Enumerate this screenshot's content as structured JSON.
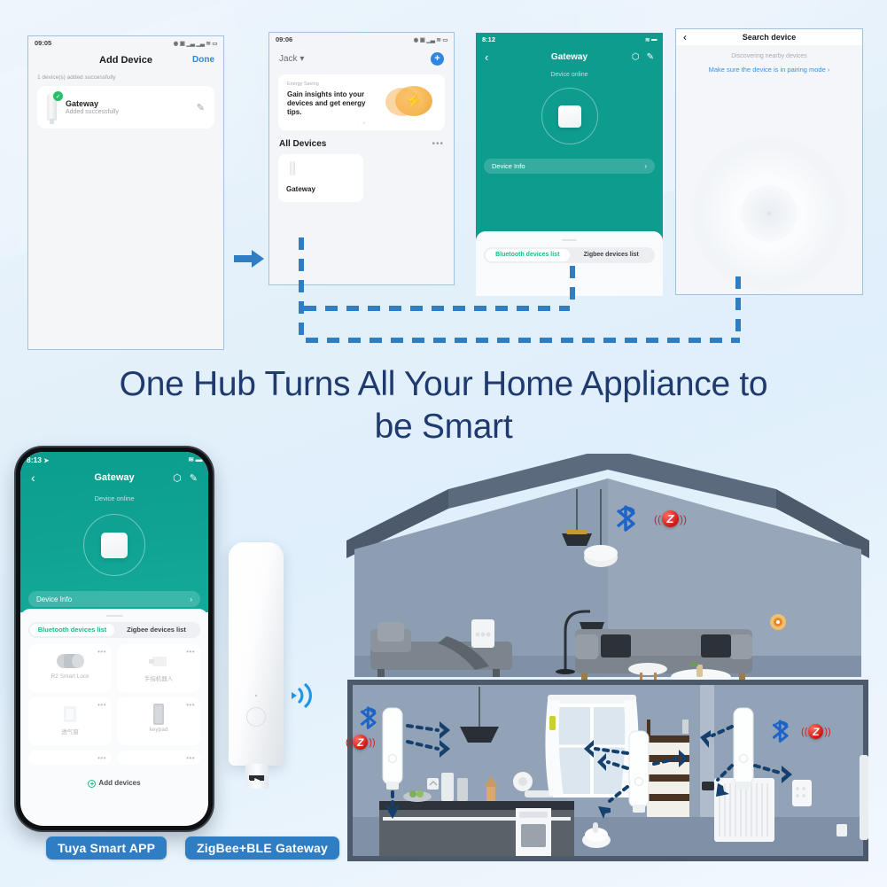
{
  "headline": {
    "line1": "One Hub Turns All Your Home Appliance to",
    "line2": "be Smart"
  },
  "labels": {
    "app_pill": "Tuya Smart APP",
    "gateway_pill": "ZigBee+BLE Gateway"
  },
  "colors": {
    "brand_blue": "#2f7ec4",
    "teal": "#10a393",
    "accent_green": "#19b98b",
    "zigbee_red": "#cc1612",
    "bluetooth_blue": "#1d63c8",
    "headline_navy": "#1f3a6e"
  },
  "shot1": {
    "status_time": "09:05",
    "status_icons": [
      "alarm-icon",
      "sim-icon",
      "signal-icon",
      "signal-icon",
      "wifi-icon",
      "battery-icon"
    ],
    "nav_title": "Add Device",
    "done_label": "Done",
    "summary": "1 device(s) added successfully",
    "device": {
      "name": "Gateway",
      "status": "Added successfully",
      "check": "✓",
      "edit_icon": "pencil-icon"
    }
  },
  "shot2": {
    "status_time": "09:06",
    "user": "Jack",
    "dropdown_icon": "chevron-down-icon",
    "add_icon": "+",
    "promo": {
      "kicker": "Energy Saving",
      "text": "Gain insights into your devices and get energy tips.",
      "orb_icon": "bolt-icon",
      "pager": "· •"
    },
    "section_title": "All Devices",
    "more_icon": "•••",
    "tiles": [
      {
        "name": "Gateway"
      }
    ]
  },
  "shot3": {
    "status_time": "8:12",
    "location_icon": "location-arrow-icon",
    "back_icon": "‹",
    "title": "Gateway",
    "shield_icon": "shield-icon",
    "edit_icon": "pencil-icon",
    "device_state": "Device online",
    "info_row": "Device Info",
    "info_chevron": "›",
    "tabs": [
      {
        "label": "Bluetooth devices list",
        "active": true
      },
      {
        "label": "Zigbee devices list",
        "active": false
      }
    ]
  },
  "shot4": {
    "back_icon": "‹",
    "title": "Search device",
    "subtitle": "Discovering nearby devices",
    "link": "Make sure the device is in pairing mode ›"
  },
  "bigphone": {
    "status_time": "8:13",
    "location_icon": "location-arrow-icon",
    "wifi_icon": "wifi-icon",
    "battery_icon": "battery-icon",
    "back_icon": "‹",
    "title": "Gateway",
    "shield_icon": "shield-icon",
    "edit_icon": "pencil-icon",
    "device_state": "Device online",
    "info_row": "Device Info",
    "info_chevron": "›",
    "tabs": [
      {
        "label": "Bluetooth devices list",
        "active": true
      },
      {
        "label": "Zigbee devices list",
        "active": false
      }
    ],
    "devices": [
      {
        "name": "R2 Smart Lock",
        "menu": "•••"
      },
      {
        "name": "手指机器人",
        "menu": "•••"
      },
      {
        "name": "透气窗",
        "menu": "•••"
      },
      {
        "name": "keypad",
        "menu": "•••"
      }
    ],
    "partial_menu": "•••",
    "add_devices": "Add devices"
  },
  "house": {
    "signal_icons": [
      "bluetooth-icon",
      "zigbee-icon"
    ],
    "zigbee_glyph": "Z",
    "hub_count": 3
  }
}
